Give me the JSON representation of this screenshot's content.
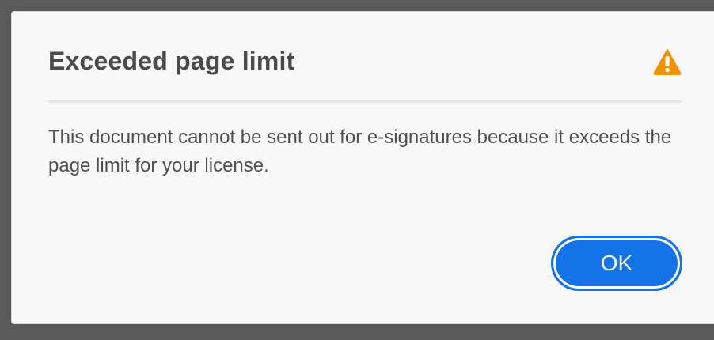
{
  "dialog": {
    "title": "Exceeded page limit",
    "icon": "warning-icon",
    "message": "This document cannot be sent out for e-signatures because it exceeds the page limit for your license.",
    "ok_label": "OK"
  },
  "colors": {
    "accent": "#1473e6",
    "warning": "#f29100",
    "title_text": "#4b4b4b",
    "body_text": "#505050",
    "backdrop": "#5a5a5a"
  }
}
